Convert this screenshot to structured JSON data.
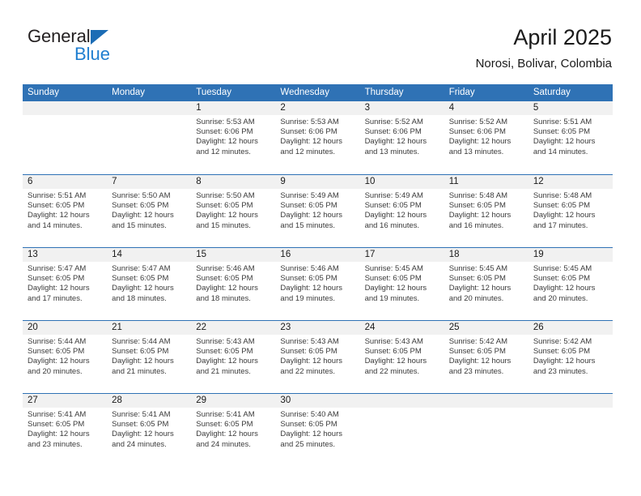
{
  "brand": {
    "name_part1": "General",
    "name_part2": "Blue",
    "triangle_icon": "triangle-right-icon",
    "accent_dark": "#231f20",
    "accent_blue": "#1f7ed0",
    "triangle_color": "#1b6cb5"
  },
  "header": {
    "title": "April 2025",
    "subtitle": "Norosi, Bolivar, Colombia"
  },
  "theme": {
    "header_blue": "#2f72b5",
    "band_gray": "#f1f1f1",
    "text_dark": "#1a1a1a",
    "text_body": "#3a3a3a"
  },
  "weekdays": [
    "Sunday",
    "Monday",
    "Tuesday",
    "Wednesday",
    "Thursday",
    "Friday",
    "Saturday"
  ],
  "weeks": [
    [
      {
        "day": "",
        "lines": [
          "",
          "",
          "",
          ""
        ],
        "empty": true
      },
      {
        "day": "",
        "lines": [
          "",
          "",
          "",
          ""
        ],
        "empty": true
      },
      {
        "day": "1",
        "lines": [
          "Sunrise: 5:53 AM",
          "Sunset: 6:06 PM",
          "Daylight: 12 hours",
          "and 12 minutes."
        ],
        "empty": false
      },
      {
        "day": "2",
        "lines": [
          "Sunrise: 5:53 AM",
          "Sunset: 6:06 PM",
          "Daylight: 12 hours",
          "and 12 minutes."
        ],
        "empty": false
      },
      {
        "day": "3",
        "lines": [
          "Sunrise: 5:52 AM",
          "Sunset: 6:06 PM",
          "Daylight: 12 hours",
          "and 13 minutes."
        ],
        "empty": false
      },
      {
        "day": "4",
        "lines": [
          "Sunrise: 5:52 AM",
          "Sunset: 6:06 PM",
          "Daylight: 12 hours",
          "and 13 minutes."
        ],
        "empty": false
      },
      {
        "day": "5",
        "lines": [
          "Sunrise: 5:51 AM",
          "Sunset: 6:05 PM",
          "Daylight: 12 hours",
          "and 14 minutes."
        ],
        "empty": false
      }
    ],
    [
      {
        "day": "6",
        "lines": [
          "Sunrise: 5:51 AM",
          "Sunset: 6:05 PM",
          "Daylight: 12 hours",
          "and 14 minutes."
        ],
        "empty": false
      },
      {
        "day": "7",
        "lines": [
          "Sunrise: 5:50 AM",
          "Sunset: 6:05 PM",
          "Daylight: 12 hours",
          "and 15 minutes."
        ],
        "empty": false
      },
      {
        "day": "8",
        "lines": [
          "Sunrise: 5:50 AM",
          "Sunset: 6:05 PM",
          "Daylight: 12 hours",
          "and 15 minutes."
        ],
        "empty": false
      },
      {
        "day": "9",
        "lines": [
          "Sunrise: 5:49 AM",
          "Sunset: 6:05 PM",
          "Daylight: 12 hours",
          "and 15 minutes."
        ],
        "empty": false
      },
      {
        "day": "10",
        "lines": [
          "Sunrise: 5:49 AM",
          "Sunset: 6:05 PM",
          "Daylight: 12 hours",
          "and 16 minutes."
        ],
        "empty": false
      },
      {
        "day": "11",
        "lines": [
          "Sunrise: 5:48 AM",
          "Sunset: 6:05 PM",
          "Daylight: 12 hours",
          "and 16 minutes."
        ],
        "empty": false
      },
      {
        "day": "12",
        "lines": [
          "Sunrise: 5:48 AM",
          "Sunset: 6:05 PM",
          "Daylight: 12 hours",
          "and 17 minutes."
        ],
        "empty": false
      }
    ],
    [
      {
        "day": "13",
        "lines": [
          "Sunrise: 5:47 AM",
          "Sunset: 6:05 PM",
          "Daylight: 12 hours",
          "and 17 minutes."
        ],
        "empty": false
      },
      {
        "day": "14",
        "lines": [
          "Sunrise: 5:47 AM",
          "Sunset: 6:05 PM",
          "Daylight: 12 hours",
          "and 18 minutes."
        ],
        "empty": false
      },
      {
        "day": "15",
        "lines": [
          "Sunrise: 5:46 AM",
          "Sunset: 6:05 PM",
          "Daylight: 12 hours",
          "and 18 minutes."
        ],
        "empty": false
      },
      {
        "day": "16",
        "lines": [
          "Sunrise: 5:46 AM",
          "Sunset: 6:05 PM",
          "Daylight: 12 hours",
          "and 19 minutes."
        ],
        "empty": false
      },
      {
        "day": "17",
        "lines": [
          "Sunrise: 5:45 AM",
          "Sunset: 6:05 PM",
          "Daylight: 12 hours",
          "and 19 minutes."
        ],
        "empty": false
      },
      {
        "day": "18",
        "lines": [
          "Sunrise: 5:45 AM",
          "Sunset: 6:05 PM",
          "Daylight: 12 hours",
          "and 20 minutes."
        ],
        "empty": false
      },
      {
        "day": "19",
        "lines": [
          "Sunrise: 5:45 AM",
          "Sunset: 6:05 PM",
          "Daylight: 12 hours",
          "and 20 minutes."
        ],
        "empty": false
      }
    ],
    [
      {
        "day": "20",
        "lines": [
          "Sunrise: 5:44 AM",
          "Sunset: 6:05 PM",
          "Daylight: 12 hours",
          "and 20 minutes."
        ],
        "empty": false
      },
      {
        "day": "21",
        "lines": [
          "Sunrise: 5:44 AM",
          "Sunset: 6:05 PM",
          "Daylight: 12 hours",
          "and 21 minutes."
        ],
        "empty": false
      },
      {
        "day": "22",
        "lines": [
          "Sunrise: 5:43 AM",
          "Sunset: 6:05 PM",
          "Daylight: 12 hours",
          "and 21 minutes."
        ],
        "empty": false
      },
      {
        "day": "23",
        "lines": [
          "Sunrise: 5:43 AM",
          "Sunset: 6:05 PM",
          "Daylight: 12 hours",
          "and 22 minutes."
        ],
        "empty": false
      },
      {
        "day": "24",
        "lines": [
          "Sunrise: 5:43 AM",
          "Sunset: 6:05 PM",
          "Daylight: 12 hours",
          "and 22 minutes."
        ],
        "empty": false
      },
      {
        "day": "25",
        "lines": [
          "Sunrise: 5:42 AM",
          "Sunset: 6:05 PM",
          "Daylight: 12 hours",
          "and 23 minutes."
        ],
        "empty": false
      },
      {
        "day": "26",
        "lines": [
          "Sunrise: 5:42 AM",
          "Sunset: 6:05 PM",
          "Daylight: 12 hours",
          "and 23 minutes."
        ],
        "empty": false
      }
    ],
    [
      {
        "day": "27",
        "lines": [
          "Sunrise: 5:41 AM",
          "Sunset: 6:05 PM",
          "Daylight: 12 hours",
          "and 23 minutes."
        ],
        "empty": false
      },
      {
        "day": "28",
        "lines": [
          "Sunrise: 5:41 AM",
          "Sunset: 6:05 PM",
          "Daylight: 12 hours",
          "and 24 minutes."
        ],
        "empty": false
      },
      {
        "day": "29",
        "lines": [
          "Sunrise: 5:41 AM",
          "Sunset: 6:05 PM",
          "Daylight: 12 hours",
          "and 24 minutes."
        ],
        "empty": false
      },
      {
        "day": "30",
        "lines": [
          "Sunrise: 5:40 AM",
          "Sunset: 6:05 PM",
          "Daylight: 12 hours",
          "and 25 minutes."
        ],
        "empty": false
      },
      {
        "day": "",
        "lines": [
          "",
          "",
          "",
          ""
        ],
        "empty": true
      },
      {
        "day": "",
        "lines": [
          "",
          "",
          "",
          ""
        ],
        "empty": true
      },
      {
        "day": "",
        "lines": [
          "",
          "",
          "",
          ""
        ],
        "empty": true
      }
    ]
  ]
}
